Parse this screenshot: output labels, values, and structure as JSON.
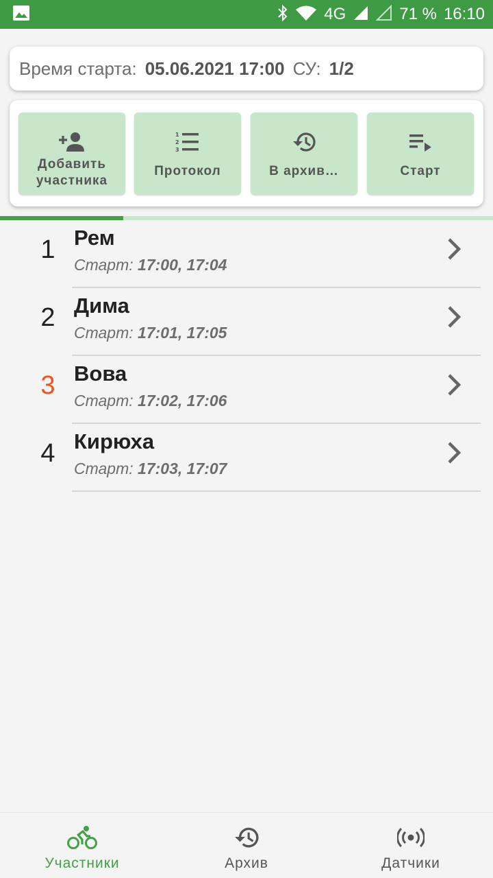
{
  "status_bar": {
    "network": "4G",
    "battery": "71 %",
    "time": "16:10"
  },
  "info": {
    "start_label": "Время старта:",
    "start_value": "05.06.2021 17:00",
    "su_label": "СУ:",
    "su_value": "1/2"
  },
  "actions": [
    {
      "label": "Добавить участника",
      "icon": "person-add-icon"
    },
    {
      "label": "Протокол",
      "icon": "numbered-list-icon"
    },
    {
      "label": "В архив…",
      "icon": "history-icon"
    },
    {
      "label": "Старт",
      "icon": "playlist-play-icon"
    }
  ],
  "progress": {
    "fraction": 0.25
  },
  "participants": [
    {
      "num": "1",
      "name": "Рем",
      "start_label": "Старт:",
      "times": "17:00, 17:04",
      "active": false
    },
    {
      "num": "2",
      "name": "Дима",
      "start_label": "Старт:",
      "times": "17:01, 17:05",
      "active": false
    },
    {
      "num": "3",
      "name": "Вова",
      "start_label": "Старт:",
      "times": "17:02, 17:06",
      "active": true
    },
    {
      "num": "4",
      "name": "Кирюха",
      "start_label": "Старт:",
      "times": "17:03, 17:07",
      "active": false
    }
  ],
  "colors": {
    "primary": "#43a047",
    "status_bar": "#3f9b43",
    "button_bg": "#c8e6c9",
    "active_number": "#f4511e"
  },
  "bottom_nav": [
    {
      "label": "Участники",
      "icon": "bike-icon",
      "active": true
    },
    {
      "label": "Архив",
      "icon": "history-icon",
      "active": false
    },
    {
      "label": "Датчики",
      "icon": "sensors-icon",
      "active": false
    }
  ]
}
